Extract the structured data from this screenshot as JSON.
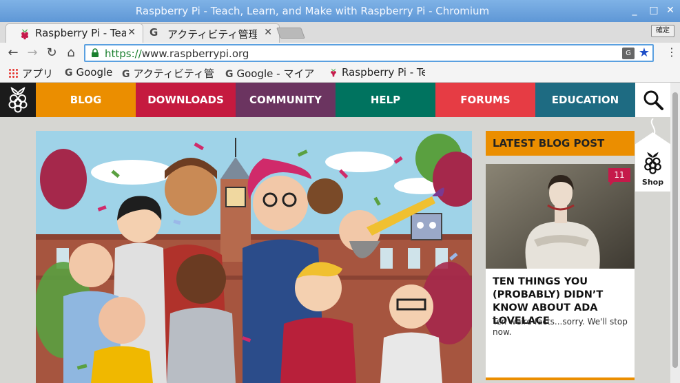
{
  "window": {
    "title": "Raspberry Pi - Teach, Learn, and Make with Raspberry Pi - Chromium",
    "controls": {
      "minimize": "_",
      "maximize": "□",
      "close": "✕"
    }
  },
  "tabs": [
    {
      "label": "Raspberry Pi - Teach, Learn, and Make",
      "icon": "raspberry-icon",
      "active": true
    },
    {
      "label": "アクティビティ管理",
      "icon": "google-icon",
      "active": false
    }
  ],
  "ime_label": "確定",
  "toolbar": {
    "back": "←",
    "forward": "→",
    "reload": "↻",
    "home": "⌂",
    "url_scheme": "https://",
    "url_rest": "www.raspberrypi.org",
    "translate": "G",
    "star": "★",
    "menu": "⋮"
  },
  "bookmarks": [
    {
      "label": "アプリ",
      "icon": "apps-grid-icon"
    },
    {
      "label": "Google",
      "icon": "google-icon"
    },
    {
      "label": "アクティビティ管",
      "icon": "google-icon"
    },
    {
      "label": "Google - マイア",
      "icon": "google-icon"
    },
    {
      "label": "Raspberry Pi - Te",
      "icon": "raspberry-icon"
    }
  ],
  "site_nav": [
    {
      "label": "BLOG",
      "color": "#eb8e00"
    },
    {
      "label": "DOWNLOADS",
      "color": "#c51a3f"
    },
    {
      "label": "COMMUNITY",
      "color": "#6b3460"
    },
    {
      "label": "HELP",
      "color": "#00735f"
    },
    {
      "label": "FORUMS",
      "color": "#e63c44"
    },
    {
      "label": "EDUCATION",
      "color": "#1e6b82"
    }
  ],
  "shop_label": "Shop",
  "blog": {
    "header": "LATEST BLOG POST",
    "comment_count": "11",
    "title": "TEN THINGS YOU (PROBABLY) DIDN’T KNOW ABOUT ADA LOVELACE",
    "excerpt": "Ten weird facts...sorry. We'll stop now."
  }
}
